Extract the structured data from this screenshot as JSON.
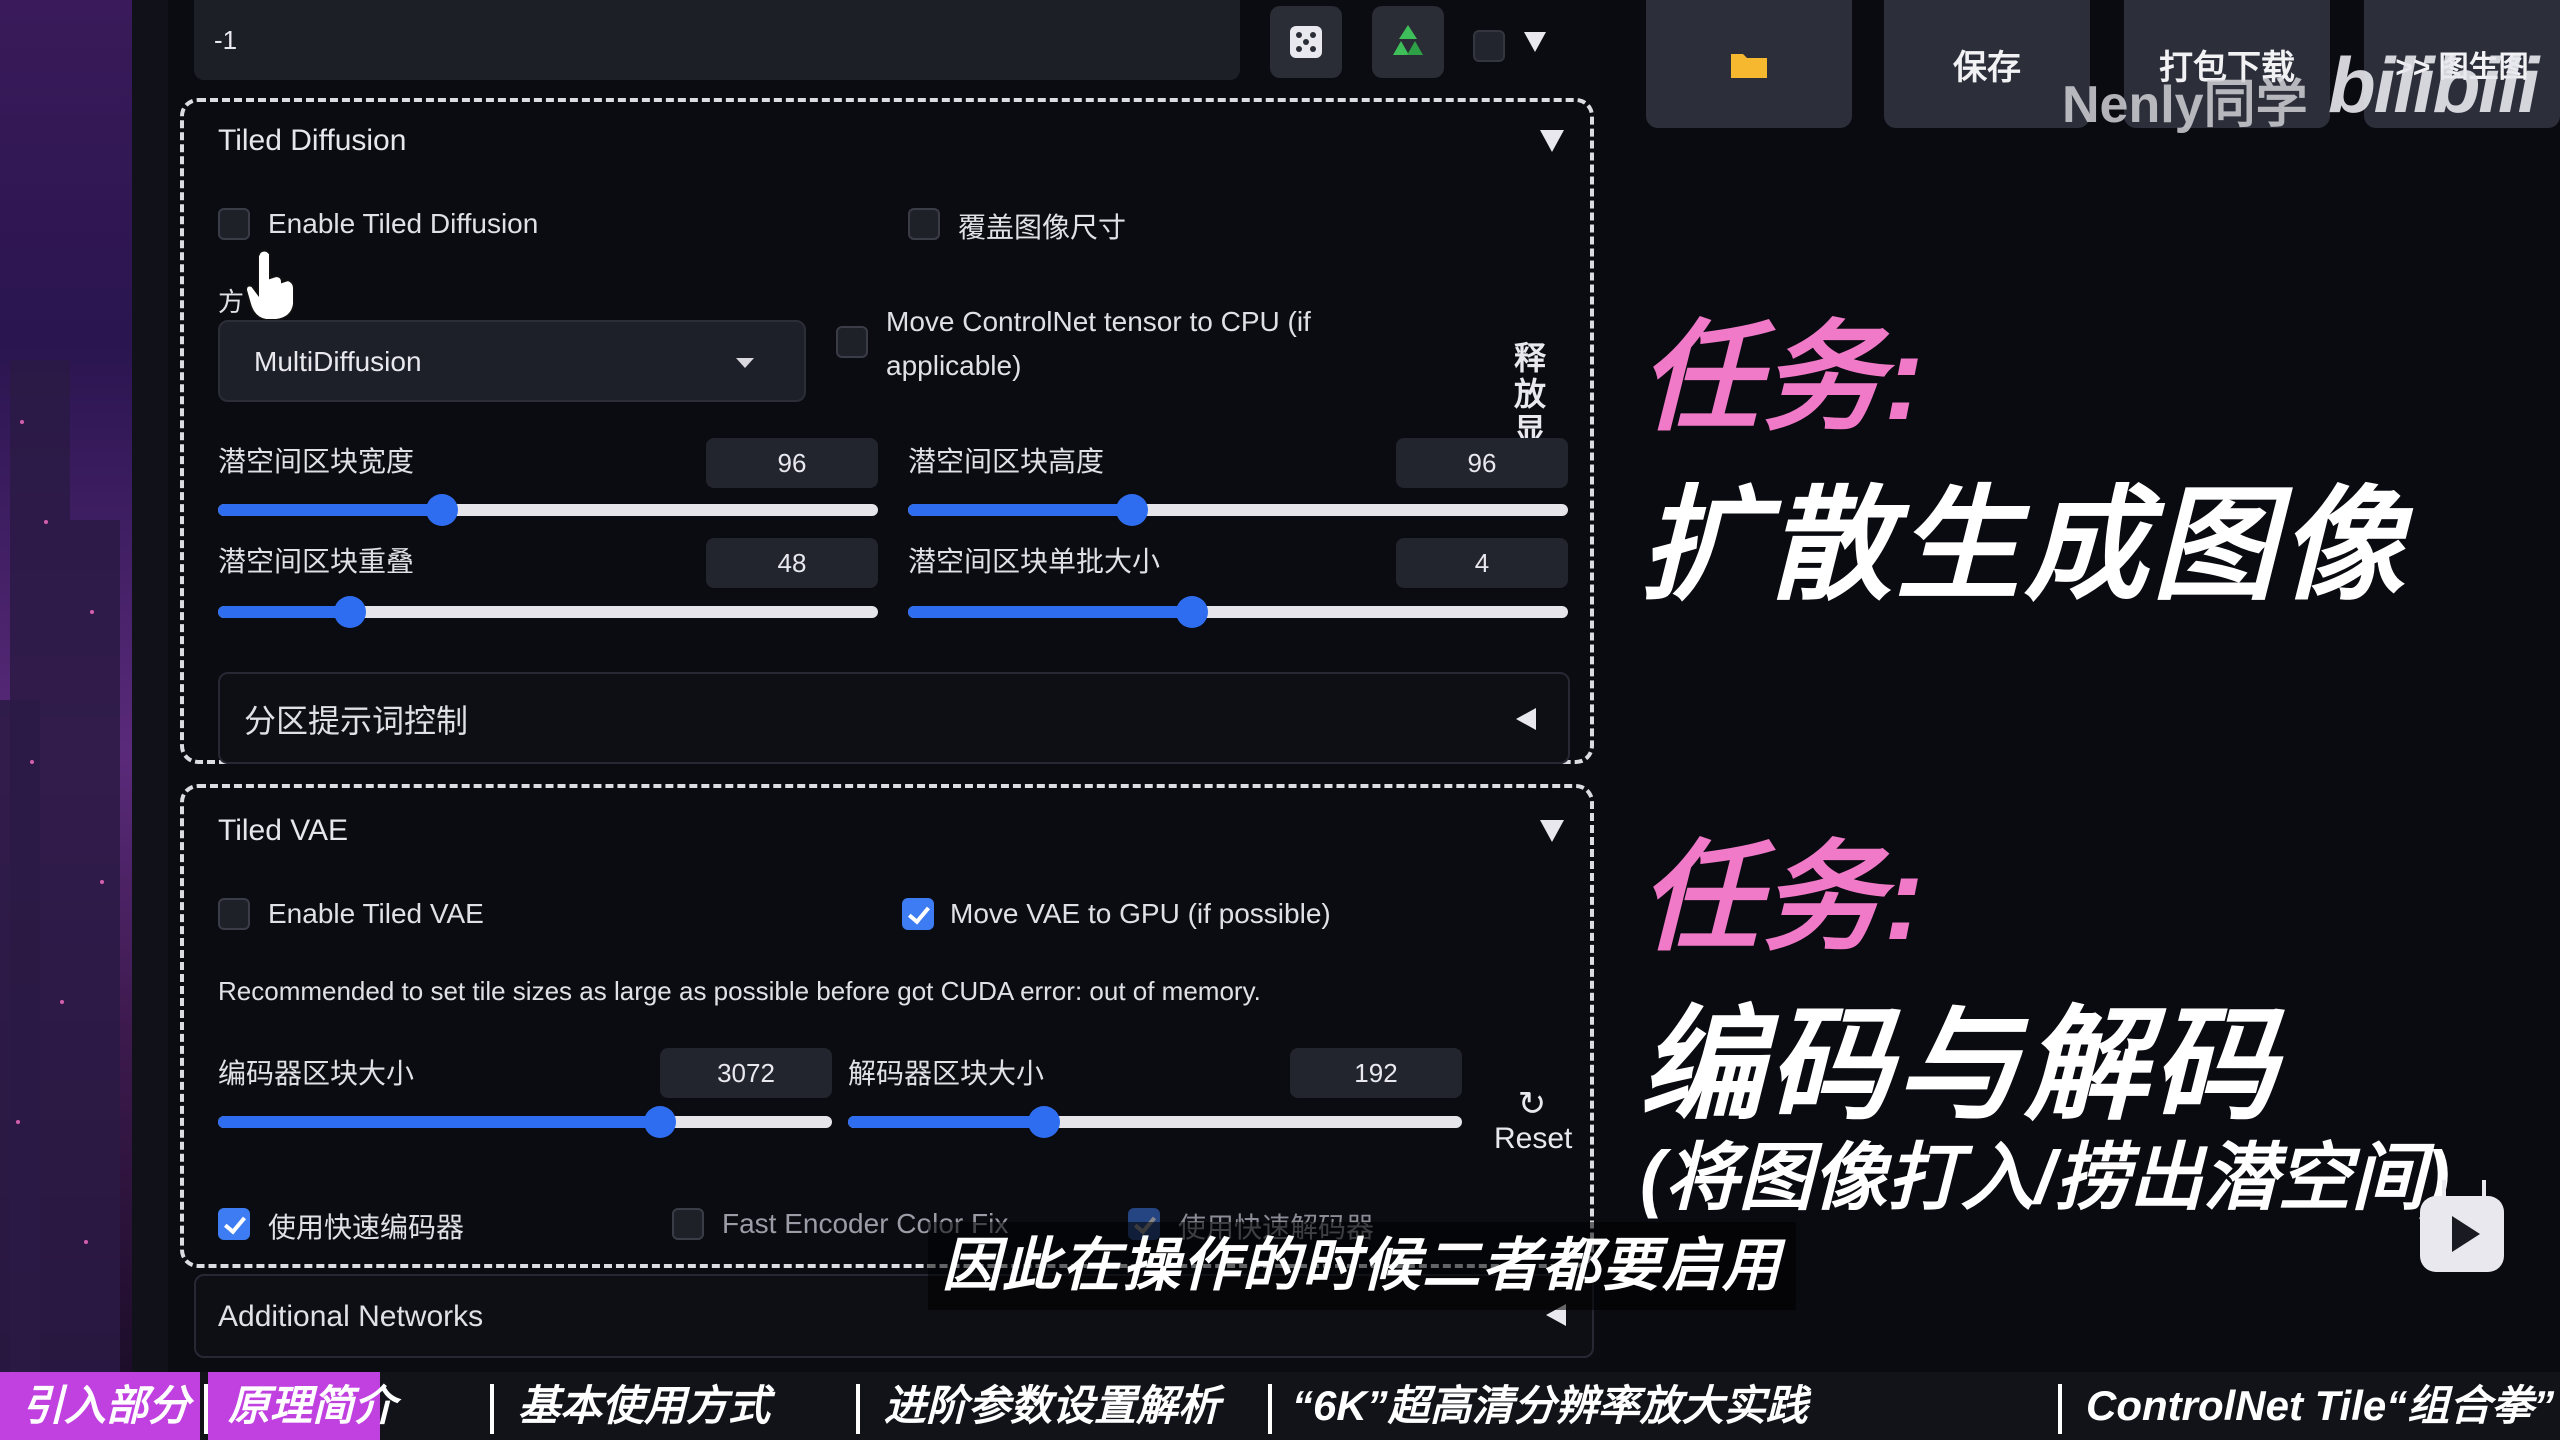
{
  "top_bar": {
    "seed_value": "-1",
    "dice_icon": "dice-icon",
    "recycle_icon": "recycle-icon",
    "folder_icon": "folder-icon",
    "save_label": "保存",
    "package_download_label": "打包下载",
    "to_img2img_label": ">> 图生图",
    "watermark": "Nenly同学",
    "logo": "bilibili"
  },
  "tiled_diffusion": {
    "title": "Tiled Diffusion",
    "enable_label": "Enable Tiled Diffusion",
    "enable_checked": false,
    "override_size_label": "覆盖图像尺寸",
    "override_size_checked": false,
    "method_label": "方",
    "method_value": "MultiDiffusion",
    "move_controlnet_label_1": "Move ControlNet tensor to CPU (if",
    "move_controlnet_label_2": "applicable)",
    "move_controlnet_checked": false,
    "vertical_label": "释放显",
    "tile_width_label": "潜空间区块宽度",
    "tile_width_value": "96",
    "tile_width_fraction": 0.34,
    "tile_height_label": "潜空间区块高度",
    "tile_height_value": "96",
    "tile_height_fraction": 0.34,
    "tile_overlap_label": "潜空间区块重叠",
    "tile_overlap_value": "48",
    "tile_overlap_fraction": 0.2,
    "tile_batch_label": "潜空间区块单批大小",
    "tile_batch_value": "4",
    "tile_batch_fraction": 0.43,
    "region_prompt_label": "分区提示词控制"
  },
  "tiled_vae": {
    "title": "Tiled VAE",
    "enable_label": "Enable Tiled VAE",
    "enable_checked": false,
    "move_vae_label": "Move VAE to GPU (if possible)",
    "move_vae_checked": true,
    "recommendation": "Recommended to set tile sizes as large as possible before got CUDA error: out of memory.",
    "encoder_tile_label": "编码器区块大小",
    "encoder_tile_value": "3072",
    "encoder_tile_fraction": 0.72,
    "decoder_tile_label": "解码器区块大小",
    "decoder_tile_value": "192",
    "decoder_tile_fraction": 0.32,
    "reset_label": "Reset",
    "fast_encoder_label": "使用快速编码器",
    "fast_encoder_checked": true,
    "fast_encoder_color_fix_label": "Fast Encoder Color Fix",
    "fast_encoder_color_fix_checked": false,
    "fast_decoder_label": "使用快速解码器",
    "fast_decoder_checked": true
  },
  "additional_networks": {
    "label": "Additional Networks"
  },
  "annotation": {
    "task1_title": "任务:",
    "task1_body": "扩散生成图像",
    "task2_title": "任务:",
    "task2_body": "编码与解码",
    "task2_note": "(将图像打入/捞出潜空间)",
    "accent_color": "#f07ac8"
  },
  "subtitle": "因此在操作的时候二者都要启用",
  "chapters": [
    {
      "label": "引入部分",
      "active": true
    },
    {
      "label": "原理简介",
      "active": true
    },
    {
      "label": "基本使用方式",
      "active": false
    },
    {
      "label": "进阶参数设置解析",
      "active": false
    },
    {
      "label": "“6K”超高清分辨率放大实践",
      "active": false
    },
    {
      "label": "ControlNet Tile“组合拳”",
      "active": false
    }
  ]
}
